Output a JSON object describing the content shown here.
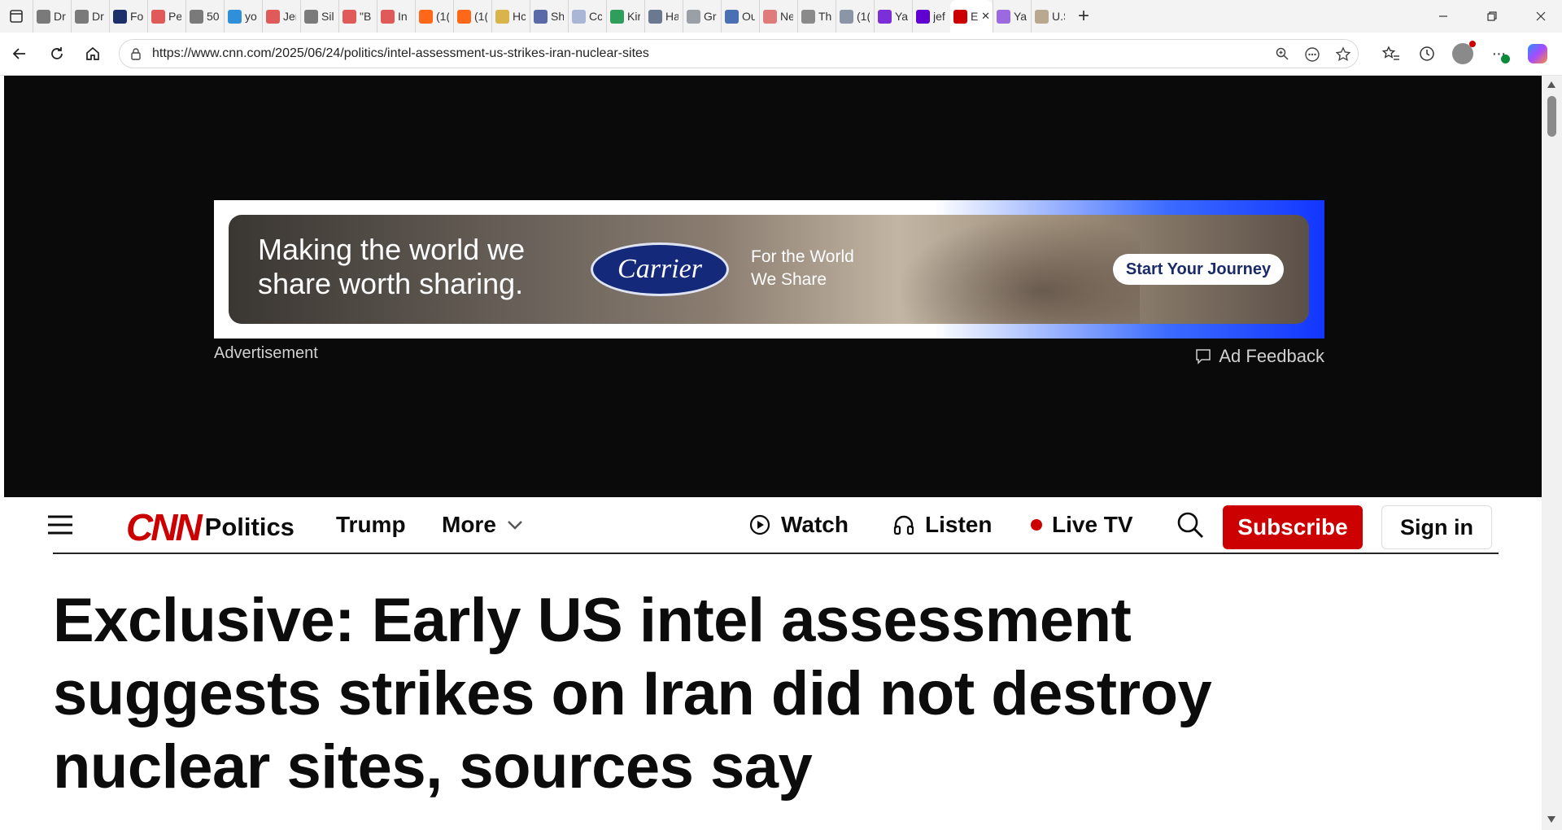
{
  "browser": {
    "tabs": [
      {
        "title": "Dr",
        "icon": "globe-icon",
        "color": "#7a7a7a"
      },
      {
        "title": "Dr",
        "icon": "globe-icon",
        "color": "#7a7a7a"
      },
      {
        "title": "Fo",
        "icon": "fox-news-icon",
        "color": "#1c2f6b"
      },
      {
        "title": "Pe",
        "icon": "youtube-icon",
        "color": "#e05a5a"
      },
      {
        "title": "50",
        "icon": "globe-icon",
        "color": "#7a7a7a"
      },
      {
        "title": "yo",
        "icon": "bing-icon",
        "color": "#2f8fd8"
      },
      {
        "title": "Jer",
        "icon": "youtube-icon",
        "color": "#e05a5a"
      },
      {
        "title": "Sil",
        "icon": "globe-icon",
        "color": "#7a7a7a"
      },
      {
        "title": "\"B",
        "icon": "youtube-icon",
        "color": "#e05a5a"
      },
      {
        "title": "In",
        "icon": "youtube-icon",
        "color": "#e05a5a"
      },
      {
        "title": "(1(",
        "icon": "substack-icon",
        "color": "#ff6719"
      },
      {
        "title": "(1(",
        "icon": "substack-icon",
        "color": "#ff6719"
      },
      {
        "title": "Hc",
        "icon": "document-icon",
        "color": "#d9b44a"
      },
      {
        "title": "Sh",
        "icon": "medium-icon",
        "color": "#5a6aa8"
      },
      {
        "title": "Cc",
        "icon": "feather-icon",
        "color": "#a9b6d6"
      },
      {
        "title": "Kir",
        "icon": "sheet-icon",
        "color": "#2e9e5a"
      },
      {
        "title": "Ha",
        "icon": "shield-icon",
        "color": "#6a7890"
      },
      {
        "title": "Gr",
        "icon": "google-icon",
        "color": "#9aa0a6"
      },
      {
        "title": "Ou",
        "icon": "mail-icon",
        "color": "#4a6fb5"
      },
      {
        "title": "Ne",
        "icon": "news-icon",
        "color": "#e07b7b"
      },
      {
        "title": "Th",
        "icon": "gp-icon",
        "color": "#8a8a8a"
      },
      {
        "title": "(1(",
        "icon": "image-icon",
        "color": "#8a95a8"
      },
      {
        "title": "Ya",
        "icon": "yahoo-slash-icon",
        "color": "#7b2fd8"
      },
      {
        "title": "jef",
        "icon": "yahoo-icon",
        "color": "#6001d2"
      },
      {
        "title": "Ex",
        "icon": "cnn-icon",
        "color": "#cc0000",
        "active": true
      },
      {
        "title": "Ya",
        "icon": "yahoo-icon",
        "color": "#9b6ae0"
      },
      {
        "title": "U.S",
        "icon": "person-icon",
        "color": "#b8a890"
      }
    ],
    "url": "https://www.cnn.com/2025/06/24/politics/intel-assessment-us-strikes-iran-nuclear-sites"
  },
  "ad": {
    "headline": "Making the world we share worth sharing.",
    "brand": "Carrier",
    "tagline": "For the World\nWe Share",
    "cta": "Start Your Journey",
    "label": "Advertisement",
    "feedback": "Ad Feedback"
  },
  "nav": {
    "logo": "CNN",
    "section": "Politics",
    "trump": "Trump",
    "more": "More",
    "watch": "Watch",
    "listen": "Listen",
    "live_tv": "Live TV",
    "subscribe": "Subscribe",
    "sign_in": "Sign in"
  },
  "article": {
    "headline": "Exclusive: Early US intel assessment suggests strikes on Iran did not destroy nuclear sites, sources say"
  },
  "colors": {
    "brand_red": "#cc0000",
    "ad_background": "#0a0a0a"
  }
}
